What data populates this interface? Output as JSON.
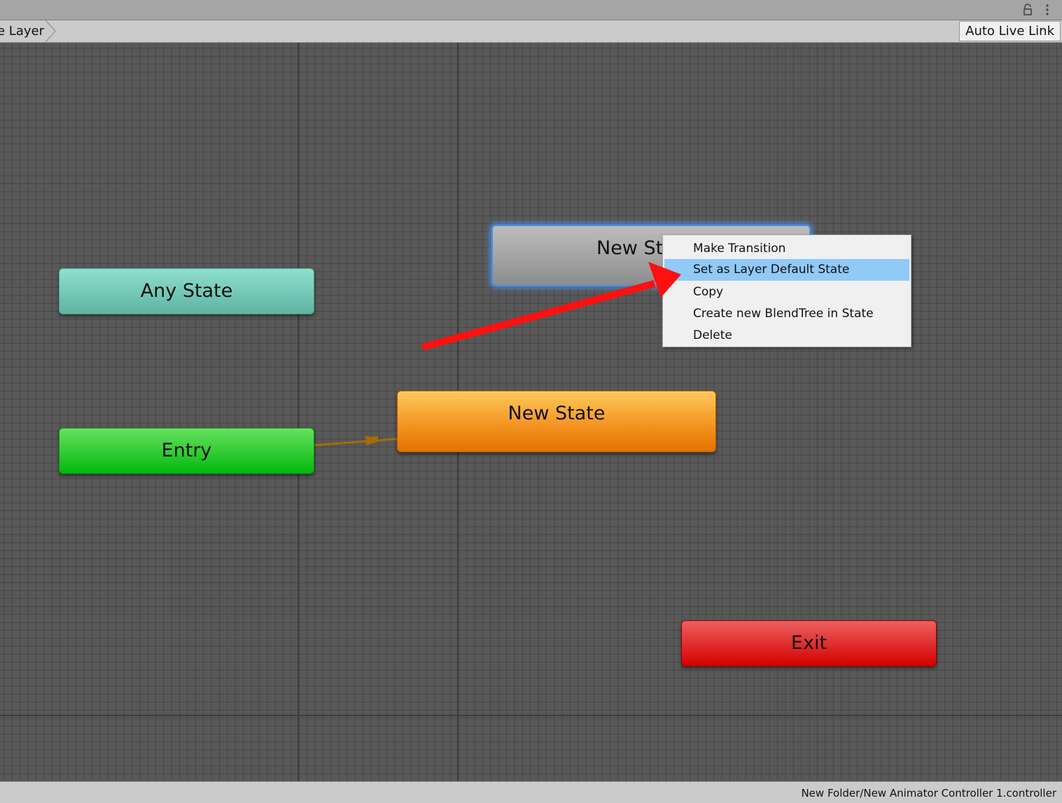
{
  "toolbar": {
    "breadcrumb": "e Layer",
    "auto_live_link": "Auto Live Link"
  },
  "header_icons": [
    "lock-icon",
    "kebab-menu-icon"
  ],
  "states": {
    "any_state": "Any State",
    "entry": "Entry",
    "new_state": "New State",
    "new_state_selected": "New St",
    "exit": "Exit"
  },
  "context_menu": {
    "items": [
      "Make Transition",
      "Set as Layer Default State",
      "Copy",
      "Create new BlendTree in State",
      "Delete"
    ],
    "highlighted": "Set as Layer Default State"
  },
  "colors": {
    "any_state": "#6fc9b6",
    "entry": "#1fc81f",
    "default_state": "#f29a26",
    "selected_state": "#a0a0a0",
    "exit": "#e02020",
    "menu_highlight": "#91c9f7",
    "annotation_arrow": "#ff1010",
    "transition_line": "#a36d08"
  },
  "status_bar": {
    "path": "New Folder/New Animator Controller 1.controller"
  }
}
